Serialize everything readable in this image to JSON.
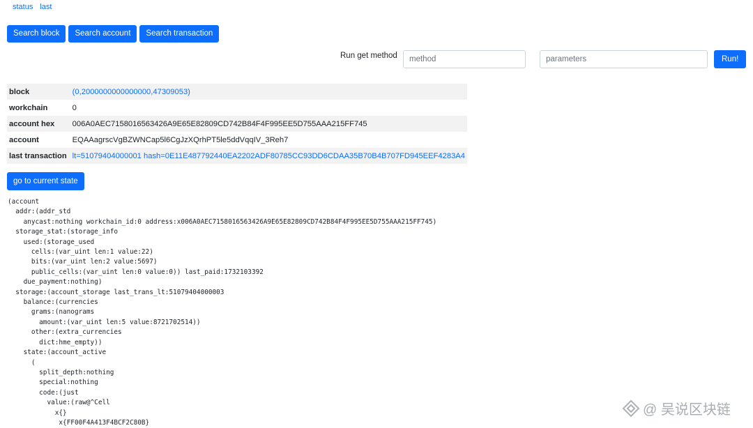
{
  "nav": {
    "status": "status",
    "last": "last"
  },
  "buttons": {
    "search_block": "Search block",
    "search_account": "Search account",
    "search_transaction": "Search transaction",
    "run": "Run!",
    "go_current": "go to current state"
  },
  "get_method": {
    "label": "Run get method",
    "method_placeholder": "method",
    "params_placeholder": "parameters"
  },
  "info": {
    "block_label": "block",
    "block_value": "(0,2000000000000000,47309053)",
    "workchain_label": "workchain",
    "workchain_value": "0",
    "account_hex_label": "account hex",
    "account_hex_value": "006A0AEC7158016563426A9E65E82809CD742B84F4F995EE5D755AAA215FF745",
    "account_label": "account",
    "account_value": "EQAAagrscVgBZWNCap5l6CgJzXQrhPT5le5ddVqqIV_3Reh7",
    "last_tx_label": "last transaction",
    "last_tx_value": "lt=51079404000001 hash=0E11E487792440EA2202ADF80785CC93DD6CDAA35B70B4B707FD945EEF4283A4"
  },
  "dump": "(account\n  addr:(addr_std\n    anycast:nothing workchain_id:0 address:x006A0AEC7158016563426A9E65E82809CD742B84F4F995EE5D755AAA215FF745)\n  storage_stat:(storage_info\n    used:(storage_used\n      cells:(var_uint len:1 value:22)\n      bits:(var_uint len:2 value:5697)\n      public_cells:(var_uint len:0 value:0)) last_paid:1732103392\n    due_payment:nothing)\n  storage:(account_storage last_trans_lt:51079404000003\n    balance:(currencies\n      grams:(nanograms\n        amount:(var_uint len:5 value:8721702514))\n      other:(extra_currencies\n        dict:hme_empty))\n    state:(account_active\n      (\n        split_depth:nothing\n        special:nothing\n        code:(just\n          value:(raw@^Cell\n            x{}\n             x{FF00F4A413F4BCF2C80B}",
  "watermark": {
    "text": "@ 吴说区块链",
    "icon": "diamond-logo-icon"
  }
}
